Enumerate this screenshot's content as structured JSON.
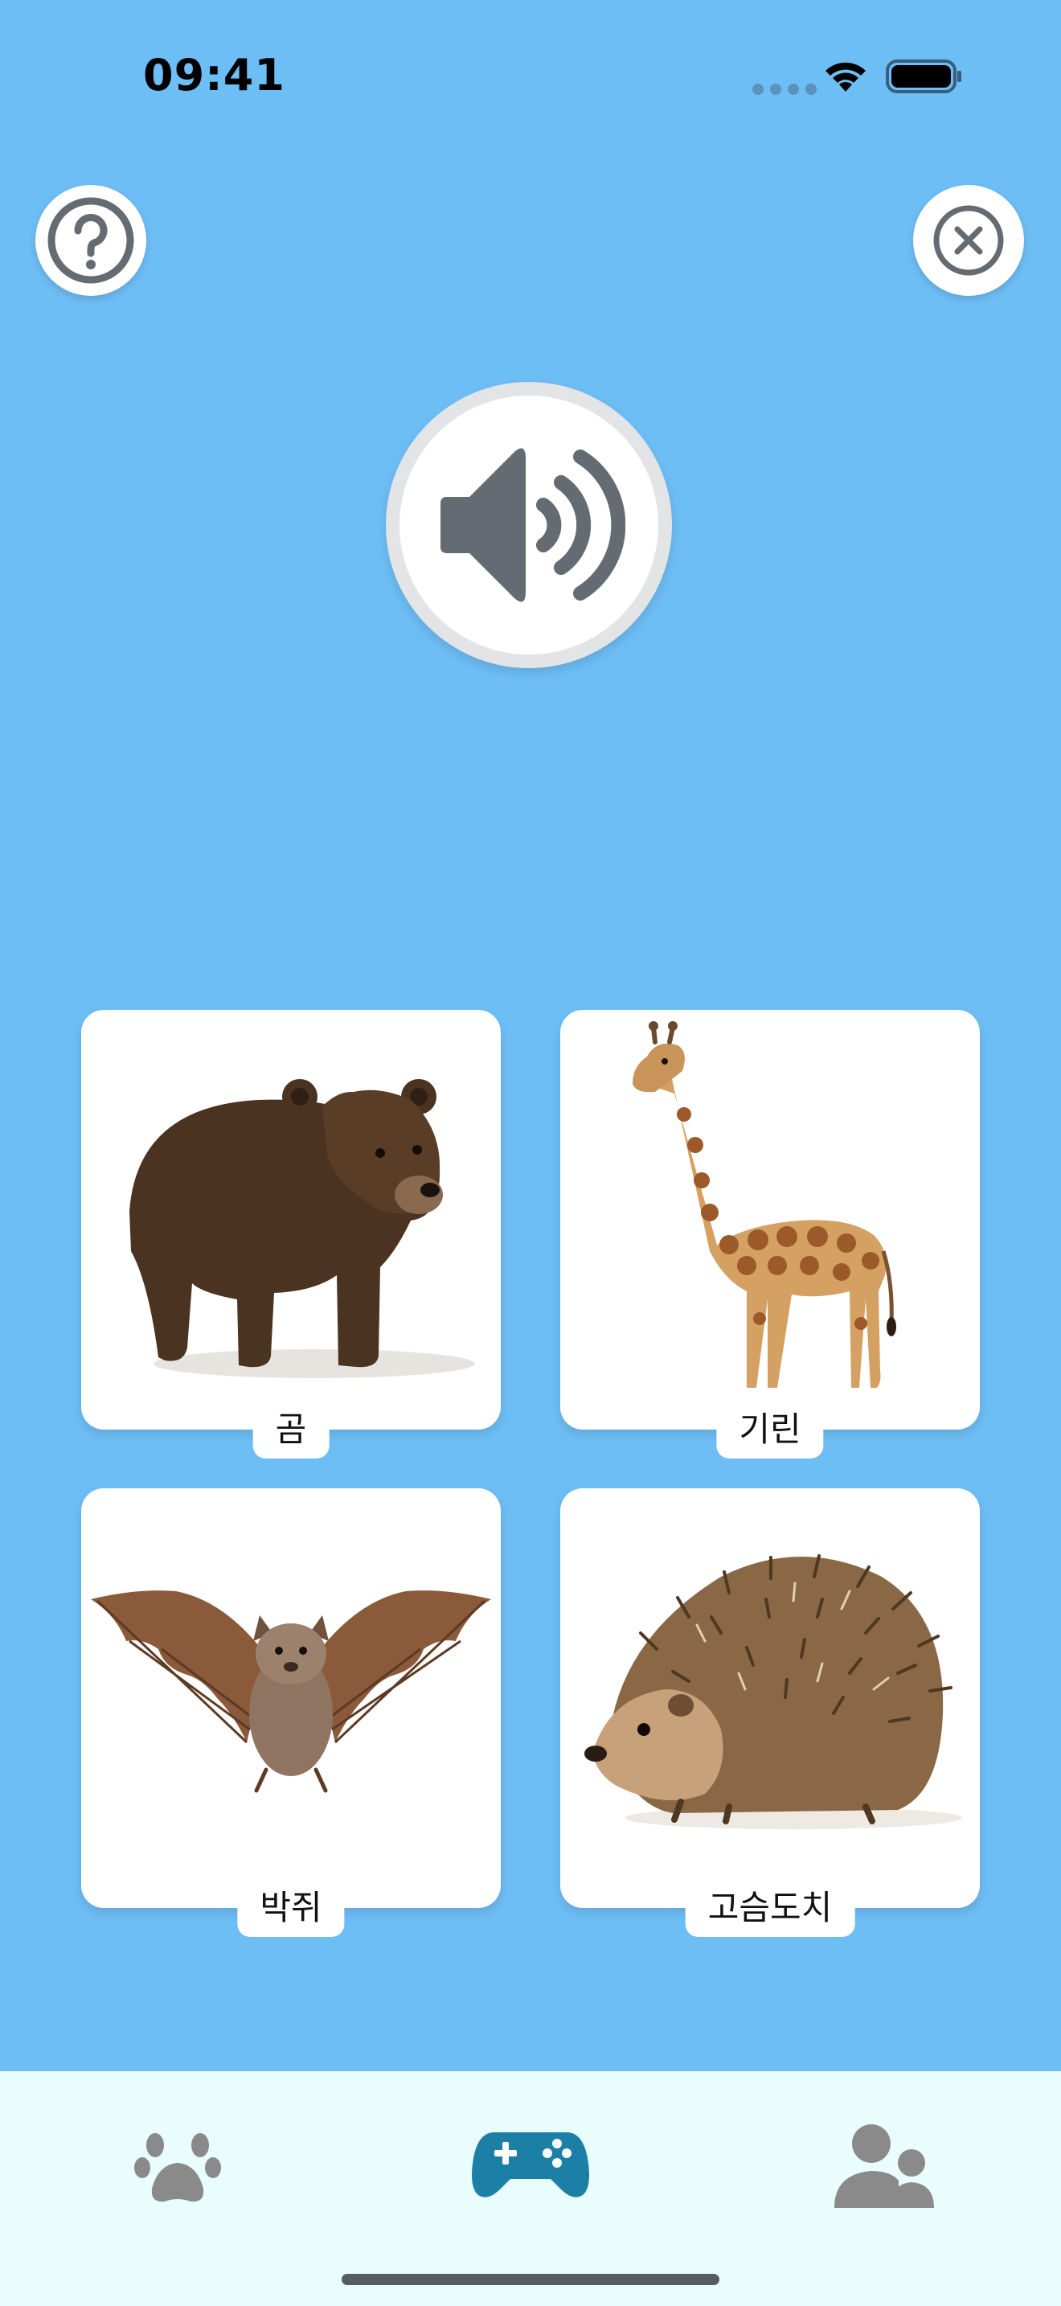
{
  "status_bar": {
    "time": "09:41",
    "icons": [
      "cellular-dots-icon",
      "wifi-icon",
      "battery-icon"
    ]
  },
  "top_buttons": {
    "help_icon": "question-circle-icon",
    "close_icon": "close-circle-icon"
  },
  "play_sound": {
    "icon": "speaker-volume-icon"
  },
  "cards": [
    {
      "label": "곰",
      "image": "bear"
    },
    {
      "label": "기린",
      "image": "giraffe"
    },
    {
      "label": "박쥐",
      "image": "bat"
    },
    {
      "label": "고슴도치",
      "image": "hedgehog"
    }
  ],
  "tab_bar": {
    "tabs": [
      {
        "icon": "paw-icon",
        "active": false
      },
      {
        "icon": "gamepad-icon",
        "active": true
      },
      {
        "icon": "users-icon",
        "active": false
      }
    ]
  },
  "colors": {
    "background": "#6ebef6",
    "tab_bar": "#e9fdfd",
    "active_tab": "#1c7fa6",
    "inactive_tab": "#8a8a8a",
    "icon_gray": "#646b73"
  }
}
